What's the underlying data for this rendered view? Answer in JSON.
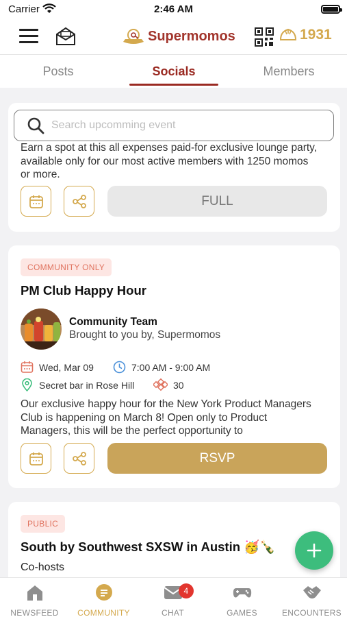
{
  "status_bar": {
    "carrier": "Carrier",
    "time": "2:46 AM"
  },
  "header": {
    "brand": "Supermomos",
    "coin_count": "1931"
  },
  "tabs": [
    {
      "label": "Posts"
    },
    {
      "label": "Socials"
    },
    {
      "label": "Members"
    }
  ],
  "search": {
    "placeholder": "Search upcomming event"
  },
  "events": [
    {
      "description": "Earn a spot at this all expenses paid-for exclusive lounge party, available only for our most active members with 1250 momos or more.",
      "action_label": "FULL"
    },
    {
      "badge": "COMMUNITY ONLY",
      "title": "PM Club Happy Hour",
      "host_name": "Community Team",
      "host_sub": "Brought to you by, Supermomos",
      "date": "Wed, Mar 09",
      "time": "7:00 AM - 9:00 AM",
      "location": "Secret bar in Rose Hill",
      "attendees": "30",
      "description": "Our exclusive happy hour for the New York Product Managers Club is happening on March 8! Open only to Product Managers, this will be the perfect opportunity to",
      "action_label": "RSVP"
    },
    {
      "badge": "PUBLIC",
      "title": "South by Southwest SXSW in Austin 🥳🍾",
      "cohosts_label": "Co-hosts"
    }
  ],
  "bottom_nav": [
    {
      "label": "NEWSFEED"
    },
    {
      "label": "COMMUNITY"
    },
    {
      "label": "CHAT",
      "badge": "4"
    },
    {
      "label": "GAMES"
    },
    {
      "label": "ENCOUNTERS"
    }
  ],
  "colors": {
    "brand": "#a2352c",
    "gold": "#d4a94e",
    "fab": "#3dbd7d",
    "badge_red": "#e2352e"
  }
}
